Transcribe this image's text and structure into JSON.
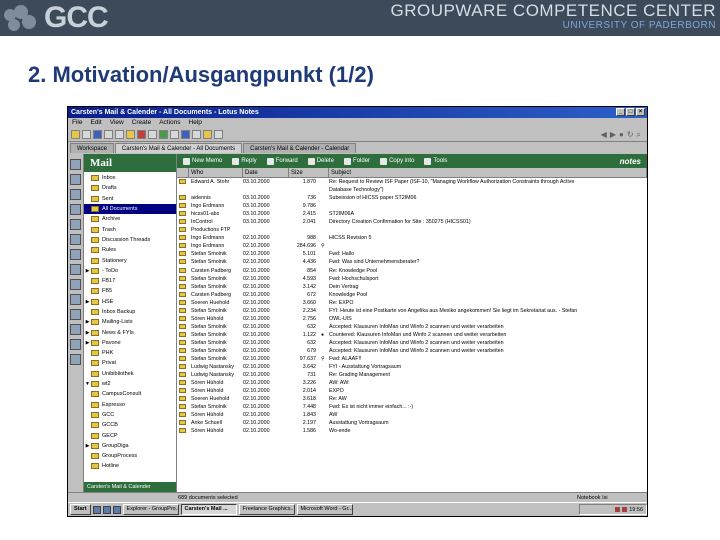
{
  "header": {
    "logo_text": "GCC",
    "title": "GROUPWARE COMPETENCE CENTER",
    "subtitle": "UNIVERSITY OF PADERBORN"
  },
  "slide": {
    "title": "2. Motivation/Ausgangpunkt (1/2)"
  },
  "window": {
    "title": "Carsten's Mail & Calender - All Documents - Lotus Notes",
    "menu": [
      "File",
      "Edit",
      "View",
      "Create",
      "Actions",
      "Help"
    ],
    "tabs": [
      "Workspace",
      "Carsten's Mail & Calender - All Documents",
      "Carsten's Mail & Calender - Calendar"
    ],
    "notes_label": "notes"
  },
  "nav": {
    "title": "Mail",
    "items": [
      {
        "label": "Inbox",
        "tw": ""
      },
      {
        "label": "Drafts",
        "tw": ""
      },
      {
        "label": "Sent",
        "tw": ""
      },
      {
        "label": "All Documents",
        "tw": "",
        "selected": true
      },
      {
        "label": "Archive",
        "tw": ""
      },
      {
        "label": "Trash",
        "tw": ""
      },
      {
        "label": "Discussion Threads",
        "tw": ""
      },
      {
        "label": "Rules",
        "tw": ""
      },
      {
        "label": "Stationery",
        "tw": ""
      },
      {
        "label": "- ToDo",
        "tw": "▶"
      },
      {
        "label": "FB17",
        "tw": ""
      },
      {
        "label": "FB5",
        "tw": ""
      },
      {
        "label": "HSE",
        "tw": "▶"
      },
      {
        "label": "Inbox Backup",
        "tw": ""
      },
      {
        "label": "Mailing-Lists",
        "tw": "▶"
      },
      {
        "label": "News & FYIs",
        "tw": "▶"
      },
      {
        "label": "Pavone",
        "tw": "▶"
      },
      {
        "label": "PHK",
        "tw": ""
      },
      {
        "label": "Privat",
        "tw": ""
      },
      {
        "label": "Unibibliothek",
        "tw": ""
      },
      {
        "label": "wt2",
        "tw": "▼"
      },
      {
        "label": "CampusConsult",
        "tw": ""
      },
      {
        "label": "Espresso",
        "tw": ""
      },
      {
        "label": "GCC",
        "tw": ""
      },
      {
        "label": "GCCB",
        "tw": ""
      },
      {
        "label": "GECP",
        "tw": ""
      },
      {
        "label": "GroupDiga",
        "tw": "▶"
      },
      {
        "label": "GroupProcess",
        "tw": ""
      },
      {
        "label": "Hotline",
        "tw": ""
      }
    ],
    "footer": "Carsten's Mail & Calender"
  },
  "actions": [
    "New Memo",
    "Reply",
    "Forward",
    "Delete",
    "Folder",
    "Copy into",
    "Tools"
  ],
  "columns": [
    "Who",
    "Date",
    "Size",
    "Subject"
  ],
  "rows": [
    {
      "who": "Edward A. Stohr",
      "date": "03.10.2000",
      "size": "1.870",
      "st": "",
      "subject": "Re: Request to Review ISF Paper (ISF-10, \"Managing Workflow Authorization Constraints through Active"
    },
    {
      "who": "",
      "date": "",
      "size": "",
      "st": "",
      "subject": "Database Technology\")"
    },
    {
      "who": "aidennis",
      "date": "03.10.2000",
      "size": "736",
      "st": "",
      "subject": "Subeission of HICSS paper ST2IM06"
    },
    {
      "who": "Ingo Erdmann",
      "date": "03.10.2000",
      "size": "9.786",
      "st": "",
      "subject": ""
    },
    {
      "who": "hicss01-abs",
      "date": "03.10.2000",
      "size": "2.415",
      "st": "",
      "subject": "ST2IM06A"
    },
    {
      "who": "InControl",
      "date": "03.10.2000",
      "size": "2.041",
      "st": "",
      "subject": "Directory Creation Confirmation for Site : 350275 (HICSS01)"
    },
    {
      "who": "Productions FTP",
      "date": "",
      "size": "",
      "st": "",
      "subject": ""
    },
    {
      "who": "Ingo Erdmann",
      "date": "02.10.2000",
      "size": "988",
      "st": "",
      "subject": "HICSS Revision 5"
    },
    {
      "who": "Ingo Erdmann",
      "date": "02.10.2000",
      "size": "284.696",
      "st": "⚲",
      "subject": ""
    },
    {
      "who": "Stefan Smolnik",
      "date": "02.10.2000",
      "size": "5.101",
      "st": "",
      "subject": "Fwd: Hallo"
    },
    {
      "who": "Stefan Smolnik",
      "date": "02.10.2000",
      "size": "4.436",
      "st": "",
      "subject": "Fwd: Was sind Unternehmensberater?"
    },
    {
      "who": "Carsten Padberg",
      "date": "02.10.2000",
      "size": "854",
      "st": "",
      "subject": "Re: Knowledge Pool"
    },
    {
      "who": "Stefan Smolnik",
      "date": "02.10.2000",
      "size": "4.593",
      "st": "",
      "subject": "Fwd: Hochschulsport"
    },
    {
      "who": "Stefan Smolnik",
      "date": "02.10.2000",
      "size": "3.142",
      "st": "",
      "subject": "Dein Vertrag"
    },
    {
      "who": "Carsten Padberg",
      "date": "02.10.2000",
      "size": "672",
      "st": "",
      "subject": "Knowledge Pool"
    },
    {
      "who": "Soeren Huehold",
      "date": "02.10.2000",
      "size": "3.660",
      "st": "",
      "subject": "Re: EXPO"
    },
    {
      "who": "Stefan Smolnik",
      "date": "02.10.2000",
      "size": "2.234",
      "st": "",
      "subject": "FYI: Heute ist eine Postkarte von Angelika aus Mexiko angekommen! Sie liegt im Sekretariat aus. - Stefan"
    },
    {
      "who": "Sören Hühold",
      "date": "02.10.2000",
      "size": "2.756",
      "st": "",
      "subject": "OWL-UIS"
    },
    {
      "who": "Stefan Smolnik",
      "date": "02.10.2000",
      "size": "632",
      "st": "",
      "subject": "Accepted: Klausuren InfoMan und Winfo 2 scannen und weiter verarbeiten"
    },
    {
      "who": "Stefan Smolnik",
      "date": "02.10.2000",
      "size": "1.122",
      "st": "●",
      "subject": "Countered: Klausuren InfoMan und Winfo 2 scannen und weiter verarbeiten"
    },
    {
      "who": "Stefan Smolnik",
      "date": "02.10.2000",
      "size": "632",
      "st": "",
      "subject": "Accepted: Klausuren InfoMan und Winfo 2 scannen und weiter verarbeiten"
    },
    {
      "who": "Stefan Smolnik",
      "date": "02.10.2000",
      "size": "679",
      "st": "",
      "subject": "Accepted: Klausuren InfoMan und Winfo 2 scannen und weiter verarbeiten"
    },
    {
      "who": "Stefan Smolnik",
      "date": "02.10.2000",
      "size": "97.637",
      "st": "⚲",
      "subject": "Fwd: ALAAF!!"
    },
    {
      "who": "Ludwig Nastansky",
      "date": "02.10.2000",
      "size": "3.642",
      "st": "",
      "subject": "FYI - Ausstattung Vortragsaum"
    },
    {
      "who": "Ludwig Nastansky",
      "date": "02.10.2000",
      "size": "731",
      "st": "",
      "subject": "Re: Grading Management"
    },
    {
      "who": "Sören Hühold",
      "date": "02.10.2000",
      "size": "3.226",
      "st": "",
      "subject": "AW: AW:"
    },
    {
      "who": "Sören Hühold",
      "date": "02.10.2000",
      "size": "2.014",
      "st": "",
      "subject": "EXPO"
    },
    {
      "who": "Soeren Huehold",
      "date": "02.10.2000",
      "size": "3.618",
      "st": "",
      "subject": "Re: AW"
    },
    {
      "who": "Stefan Smolnik",
      "date": "02.10.2000",
      "size": "7.448",
      "st": "",
      "subject": "Fwd: Es ist nicht immer einfach... :-)"
    },
    {
      "who": "Sören Hühold",
      "date": "02.10.2000",
      "size": "1.843",
      "st": "",
      "subject": "AW"
    },
    {
      "who": "Anke Schuell",
      "date": "02.10.2000",
      "size": "2.197",
      "st": "",
      "subject": "Ausstattung Vortragsaum"
    },
    {
      "who": "Sören Hühold",
      "date": "02.10.2000",
      "size": "1.586",
      "st": "",
      "subject": "Wo-ende"
    }
  ],
  "status": {
    "count": "689 documents selected",
    "location": "Notebook Isi"
  },
  "taskbar": {
    "start": "Start",
    "tasks": [
      "Explorer - GroupPro...",
      "Carsten's Mail ...",
      "Freelance Graphics...",
      "Microsoft Word - Gr..."
    ],
    "active_index": 1,
    "clock": "19:56"
  }
}
